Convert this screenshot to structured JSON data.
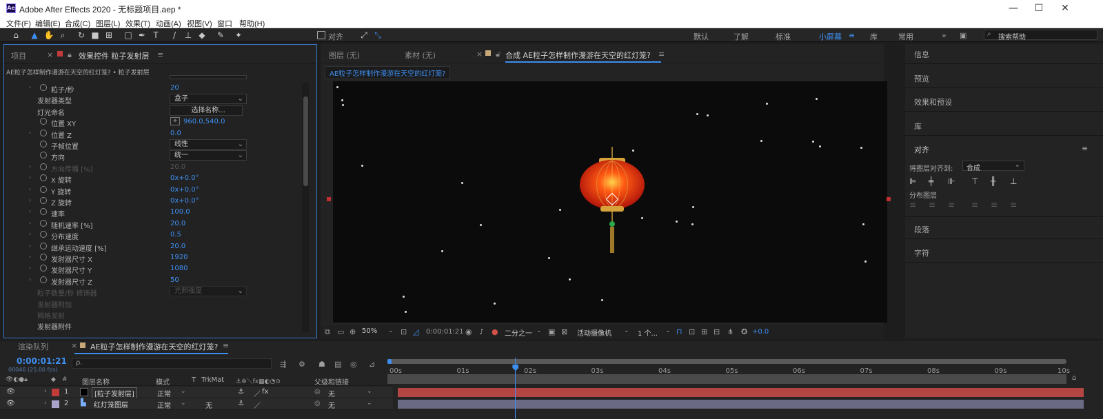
{
  "app": {
    "window_title": "Adobe After Effects 2020 - 无标题项目.aep *",
    "logo_text": "Ae"
  },
  "menu": [
    "文件(F)",
    "编辑(E)",
    "合成(C)",
    "图层(L)",
    "效果(T)",
    "动画(A)",
    "视图(V)",
    "窗口",
    "帮助(H)"
  ],
  "toolbar": {
    "snap_label": "对齐",
    "workspaces": [
      "默认",
      "了解",
      "标准",
      "小屏幕",
      "库",
      "常用"
    ],
    "active_workspace": "小屏幕",
    "search_placeholder": "搜索帮助"
  },
  "left_panel": {
    "tabs": [
      "项目",
      "效果控件 粒子发射层"
    ],
    "breadcrumb": "AE粒子怎样制作漫游在天空的红灯笼? • 粒子发射层",
    "top_partial_value": "打开",
    "properties": [
      {
        "label": "粒子/秒",
        "value": "20",
        "type": "value",
        "stopwatch": true,
        "expand": true
      },
      {
        "label": "发射器类型",
        "value": "盒子",
        "type": "dropdown"
      },
      {
        "label": "灯光命名",
        "value": "选择名称...",
        "type": "button"
      },
      {
        "label": "位置 XY",
        "value": "960.0,540.0",
        "type": "point",
        "stopwatch": true
      },
      {
        "label": "位置 Z",
        "value": "0.0",
        "type": "value",
        "stopwatch": true,
        "expand": true
      },
      {
        "label": "子帧位置",
        "value": "线性",
        "type": "dropdown",
        "stopwatch": true
      },
      {
        "label": "方向",
        "value": "统一",
        "type": "dropdown",
        "stopwatch": true
      },
      {
        "label": "方向传播 [%]",
        "value": "20.0",
        "type": "value",
        "stopwatch": true,
        "expand": true,
        "dim": true
      },
      {
        "label": "X 旋转",
        "value": "0x+0.0°",
        "type": "value",
        "stopwatch": true,
        "expand": true
      },
      {
        "label": "Y 旋转",
        "value": "0x+0.0°",
        "type": "value",
        "stopwatch": true,
        "expand": true
      },
      {
        "label": "Z 旋转",
        "value": "0x+0.0°",
        "type": "value",
        "stopwatch": true,
        "expand": true
      },
      {
        "label": "速率",
        "value": "100.0",
        "type": "value",
        "stopwatch": true,
        "expand": true
      },
      {
        "label": "随机速率 [%]",
        "value": "20.0",
        "type": "value",
        "stopwatch": true,
        "expand": true
      },
      {
        "label": "分布速度",
        "value": "0.5",
        "type": "value",
        "stopwatch": true,
        "expand": true
      },
      {
        "label": "继承运动速度 [%]",
        "value": "20.0",
        "type": "value",
        "stopwatch": true,
        "expand": true
      },
      {
        "label": "发射器尺寸 X",
        "value": "1920",
        "type": "value",
        "stopwatch": true,
        "expand": true
      },
      {
        "label": "发射器尺寸 Y",
        "value": "1080",
        "type": "value",
        "stopwatch": true,
        "expand": true
      },
      {
        "label": "发射器尺寸 Z",
        "value": "50",
        "type": "value",
        "stopwatch": true,
        "expand": true
      },
      {
        "label": "粒子数量/秒 修饰器",
        "value": "光照强度",
        "type": "dropdown",
        "dim": true
      },
      {
        "label": "发射器附加",
        "value": "",
        "type": "group",
        "dim": true
      },
      {
        "label": "网格发射",
        "value": "",
        "type": "group",
        "dim": true
      },
      {
        "label": "发射器附件",
        "value": "",
        "type": "group"
      }
    ]
  },
  "comp_panel": {
    "tabs": [
      "图层 (无)",
      "素材 (无)",
      "合成 AE粒子怎样制作漫游在天空的红灯笼?"
    ],
    "comp_name_chip": "AE粒子怎样制作漫游在天空的红灯笼?",
    "zoom": "50%",
    "timecode": "0:00:01:21",
    "resolution": "二分之一",
    "camera": "活动摄像机",
    "views": "1 个...",
    "exposure": "+0.0"
  },
  "right_panel": {
    "sections": [
      "信息",
      "预览",
      "效果和预设",
      "库",
      "对齐",
      "段落",
      "字符"
    ],
    "align_to_label": "将图层对齐到:",
    "align_to_value": "合成",
    "distribute_label": "分布图层"
  },
  "timeline": {
    "tabs": [
      "渲染队列",
      "AE粒子怎样制作漫游在天空的红灯笼?"
    ],
    "timecode": "0:00:01:21",
    "frame_info": "00046 (25.00 fps)",
    "search_placeholder": "ρ.",
    "columns": {
      "name": "图层名称",
      "mode": "模式",
      "t": "T",
      "trkmat": "TrkMat",
      "parent": "父级和链接"
    },
    "ruler": [
      "00s",
      "01s",
      "02s",
      "03s",
      "04s",
      "05s",
      "06s",
      "07s",
      "08s",
      "09s",
      "10s"
    ],
    "playhead_seconds": 1.84,
    "layers": [
      {
        "num": "1",
        "name": "[粒子发射层]",
        "mode": "正常",
        "trkmat": "",
        "parent": "无",
        "color": "#c23b3b",
        "bar_color": "#b34545"
      },
      {
        "num": "2",
        "name": "红灯笼图层",
        "mode": "正常",
        "trkmat": "无",
        "parent": "无",
        "color": "#a9a3c9",
        "bar_color": "#6b6a84"
      }
    ]
  }
}
